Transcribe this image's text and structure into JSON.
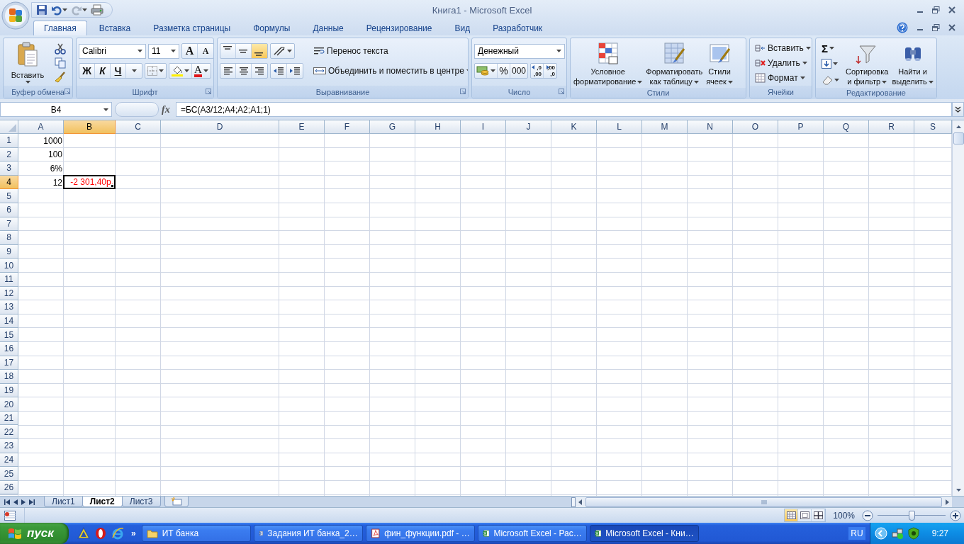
{
  "title_bar": {
    "title": "Книга1 - Microsoft Excel"
  },
  "ribbon_tabs": [
    {
      "label": "Главная",
      "selected": true
    },
    {
      "label": "Вставка",
      "selected": false
    },
    {
      "label": "Разметка страницы",
      "selected": false
    },
    {
      "label": "Формулы",
      "selected": false
    },
    {
      "label": "Данные",
      "selected": false
    },
    {
      "label": "Рецензирование",
      "selected": false
    },
    {
      "label": "Вид",
      "selected": false
    },
    {
      "label": "Разработчик",
      "selected": false
    }
  ],
  "ribbon": {
    "clipboard": {
      "label": "Буфер обмена",
      "paste": "Вставить"
    },
    "font": {
      "label": "Шрифт",
      "font_name": "Calibri",
      "font_size": "11",
      "grow_font": "A",
      "shrink_font": "A",
      "bold": "Ж",
      "italic": "К",
      "underline": "Ч",
      "font_color": "A"
    },
    "alignment": {
      "label": "Выравнивание",
      "vertical_align": [
        {
          "selected": false
        },
        {
          "selected": false
        },
        {
          "selected": true
        }
      ],
      "wrap_text": "Перенос текста",
      "merge_center": "Объединить и поместить в центре"
    },
    "number": {
      "label": "Число",
      "format": "Денежный",
      "percent": "%",
      "thousands": "000",
      "increase_decimal": [
        ",0",
        ",00"
      ],
      "decrease_decimal": [
        ",00",
        ",0"
      ]
    },
    "styles": {
      "label": "Стили",
      "buttons": [
        [
          "Условное",
          "форматирование"
        ],
        [
          "Форматировать",
          "как таблицу"
        ],
        [
          "Стили",
          "ячеек"
        ]
      ]
    },
    "cells": {
      "label": "Ячейки",
      "buttons": [
        "Вставить",
        "Удалить",
        "Формат"
      ]
    },
    "editing": {
      "label": "Редактирование",
      "autosum": "Σ",
      "buttons": [
        [
          "Сортировка",
          "и фильтр"
        ],
        [
          "Найти и",
          "выделить"
        ]
      ]
    }
  },
  "formula_bar": {
    "name_box": "B4",
    "function_label": "fx",
    "formula": "=БС(A3/12;A4;A2;A1;1)"
  },
  "sheet": {
    "columns": [
      {
        "label": "A",
        "selected": false
      },
      {
        "label": "B",
        "selected": true
      },
      {
        "label": "C",
        "selected": false
      },
      {
        "label": "D",
        "selected": false
      },
      {
        "label": "E",
        "selected": false
      },
      {
        "label": "F",
        "selected": false
      },
      {
        "label": "G",
        "selected": false
      },
      {
        "label": "H",
        "selected": false
      },
      {
        "label": "I",
        "selected": false
      },
      {
        "label": "J",
        "selected": false
      },
      {
        "label": "K",
        "selected": false
      },
      {
        "label": "L",
        "selected": false
      },
      {
        "label": "M",
        "selected": false
      },
      {
        "label": "N",
        "selected": false
      },
      {
        "label": "O",
        "selected": false
      },
      {
        "label": "P",
        "selected": false
      },
      {
        "label": "Q",
        "selected": false
      },
      {
        "label": "R",
        "selected": false
      },
      {
        "label": "S",
        "selected": false
      }
    ],
    "rows": [
      {
        "label": "1",
        "selected": false,
        "cells": [
          {
            "value": "1000",
            "active": false,
            "negative": false
          }
        ]
      },
      {
        "label": "2",
        "selected": false,
        "cells": [
          {
            "value": "100",
            "active": false,
            "negative": false
          }
        ]
      },
      {
        "label": "3",
        "selected": false,
        "cells": [
          {
            "value": "6%",
            "active": false,
            "negative": false
          }
        ]
      },
      {
        "label": "4",
        "selected": true,
        "cells": [
          {
            "value": "12",
            "active": false,
            "negative": false
          },
          {
            "value": "-2 301,40р.",
            "active": true,
            "negative": true
          }
        ]
      },
      {
        "label": "5",
        "selected": false
      },
      {
        "label": "6",
        "selected": false
      },
      {
        "label": "7",
        "selected": false
      },
      {
        "label": "8",
        "selected": false
      },
      {
        "label": "9",
        "selected": false
      },
      {
        "label": "10",
        "selected": false
      },
      {
        "label": "11",
        "selected": false
      },
      {
        "label": "12",
        "selected": false
      },
      {
        "label": "13",
        "selected": false
      },
      {
        "label": "14",
        "selected": false
      },
      {
        "label": "15",
        "selected": false
      },
      {
        "label": "16",
        "selected": false
      },
      {
        "label": "17",
        "selected": false
      },
      {
        "label": "18",
        "selected": false
      },
      {
        "label": "19",
        "selected": false
      },
      {
        "label": "20",
        "selected": false
      },
      {
        "label": "21",
        "selected": false
      },
      {
        "label": "22",
        "selected": false
      },
      {
        "label": "23",
        "selected": false
      },
      {
        "label": "24",
        "selected": false
      },
      {
        "label": "25",
        "selected": false
      },
      {
        "label": "26",
        "selected": false
      }
    ]
  },
  "sheet_tabs": [
    {
      "label": "Лист1",
      "selected": false
    },
    {
      "label": "Лист2",
      "selected": true
    },
    {
      "label": "Лист3",
      "selected": false
    }
  ],
  "status_bar": {
    "views": [
      {
        "selected": true
      },
      {
        "selected": false
      },
      {
        "selected": false
      }
    ],
    "zoom": "100%",
    "zoom_slider": {
      "level": 0.5
    }
  },
  "taskbar": {
    "start": "пуск",
    "more": "»",
    "tasks": [
      {
        "label": "ИТ банка",
        "kind": "folder",
        "selected": false
      },
      {
        "label": "Задания ИТ банка_2…",
        "kind": "word",
        "selected": false
      },
      {
        "label": "фин_функции.pdf - …",
        "kind": "pdf",
        "selected": false
      },
      {
        "label": "Microsoft Excel - Рас…",
        "kind": "excel",
        "selected": false
      },
      {
        "label": "Microsoft Excel - Кни…",
        "kind": "excel",
        "selected": true
      }
    ],
    "language": "RU",
    "clock": "9:27"
  }
}
